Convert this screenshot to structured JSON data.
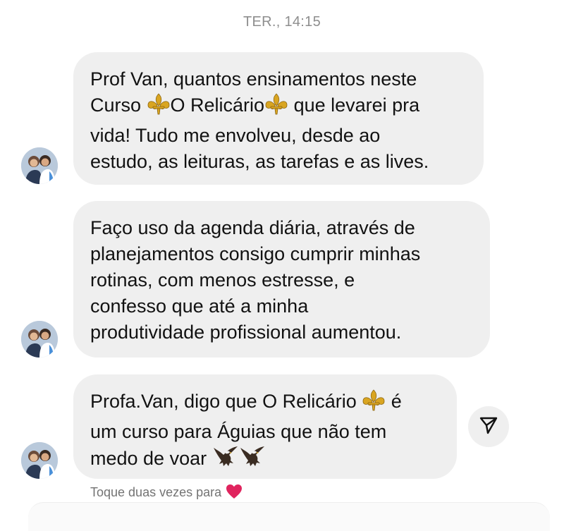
{
  "header": {
    "timestamp": "TER., 14:15"
  },
  "messages": [
    {
      "lines": [
        "Prof Van, quantos ensinamentos neste",
        [
          "Curso ",
          "fleur-de-lis",
          "O Relicário",
          "fleur-de-lis",
          " que levarei pra"
        ],
        "vida! Tudo me envolveu, desde ao",
        "estudo, as leituras, as tarefas e as lives."
      ],
      "line_texts": {
        "l1": "Prof Van, quantos ensinamentos neste",
        "l2a": "Curso ",
        "l2b": "O Relicário",
        "l2c": " que levarei pra",
        "l3": "vida! Tudo me envolveu, desde ao",
        "l4": "estudo, as leituras, as tarefas e as lives."
      }
    },
    {
      "line_texts": {
        "l1": "Faço uso da agenda diária,  através de",
        "l2": "planejamentos consigo cumprir minhas",
        "l3": "rotinas, com menos estresse, e",
        "l4": "confesso que até a minha",
        "l5": "produtividade profissional aumentou."
      }
    },
    {
      "line_texts": {
        "l1a": "Profa.Van, digo que O Relicário ",
        "l1b": " é",
        "l2": "um curso para Águias que não tem",
        "l3": "medo de voar "
      }
    }
  ],
  "footer": {
    "hint": "Toque duas vezes para"
  },
  "icons": {
    "fleur": "fleur-de-lis",
    "eagle": "eagle",
    "heart": "heart",
    "share": "paper-plane"
  },
  "colors": {
    "bubble": "#efefef",
    "timestamp": "#8e8e8e",
    "hint": "#737373",
    "heart": "#e0245e",
    "gold": "#d9a521"
  }
}
